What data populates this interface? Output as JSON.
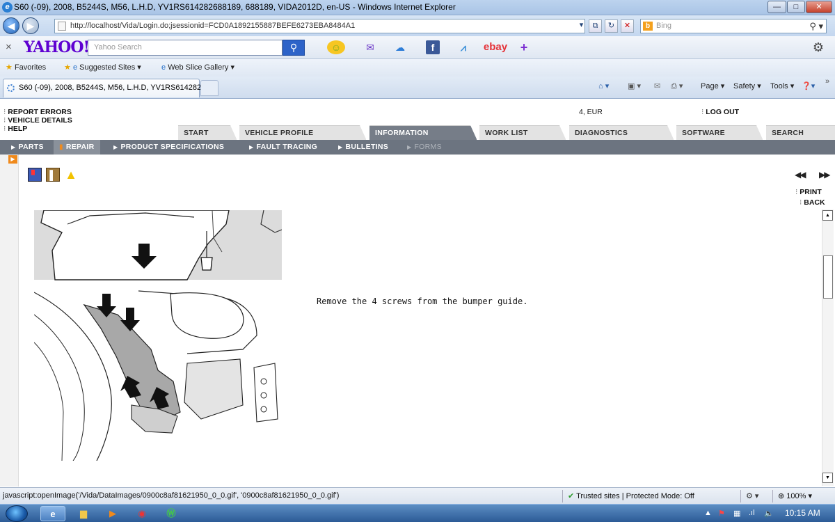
{
  "window": {
    "title": "S60 (-09), 2008, B5244S, M56, L.H.D, YV1RS614282688189, 688189, VIDA2012D, en-US - Windows Internet Explorer",
    "minimize": "—",
    "maximize": "□",
    "close": "✕"
  },
  "address": {
    "url": "http://localhost/Vida/Login.do;jsessionid=FCD0A1892155887BEFE6273EBA8484A1",
    "search_placeholder": "Bing"
  },
  "yahoo": {
    "close": "×",
    "logo": "YAHOO!",
    "search_placeholder": "Yahoo Search",
    "ebay": "ebay"
  },
  "favorites": {
    "favorites_label": "Favorites",
    "suggested_label": "Suggested Sites ▾",
    "gallery_label": "Web Slice Gallery ▾"
  },
  "tab": {
    "label": "S60 (-09), 2008, B5244S, M56, L.H.D, YV1RS614282..."
  },
  "commands": {
    "page": "Page ▾",
    "safety": "Safety ▾",
    "tools": "Tools ▾"
  },
  "vida": {
    "links": [
      "REPORT ERRORS",
      "VEHICLE DETAILS",
      "HELP"
    ],
    "locale": "4, EUR",
    "logout": "LOG OUT",
    "main_tabs": [
      "START",
      "VEHICLE PROFILE",
      "INFORMATION",
      "WORK LIST",
      "DIAGNOSTICS",
      "SOFTWARE",
      "SEARCH"
    ],
    "active_tab": "INFORMATION",
    "sub_tabs": [
      "PARTS",
      "REPAIR",
      "PRODUCT SPECIFICATIONS",
      "FAULT TRACING",
      "BULLETINS",
      "FORMS"
    ],
    "active_sub_tab": "REPAIR",
    "print": "PRINT",
    "back": "BACK",
    "prev": "◀◀",
    "next": "▶▶",
    "instruction": "Remove the 4 screws from the bumper guide."
  },
  "status": {
    "url": "javascript:openImage('/Vida/DataImages/0900c8af81621950_0_0.gif', '0900c8af81621950_0_0.gif')",
    "trusted": "Trusted sites | Protected Mode: Off",
    "zoom": "100%"
  },
  "taskbar": {
    "time": "10:15 AM"
  },
  "colors": {
    "accent_orange": "#f08a1c",
    "subnav_gray": "#6c7480",
    "active_tab": "#767d88",
    "yahoo_purple": "#5f01d1"
  },
  "icons": [
    "ie-icon",
    "back-icon",
    "forward-icon",
    "search-icon",
    "mail-icon",
    "weather-icon",
    "facebook-icon",
    "finance-icon",
    "settings-gear-icon",
    "star-icon",
    "home-icon",
    "rss-icon",
    "print-icon",
    "help-icon",
    "lock-check-icon",
    "windows-start-icon"
  ]
}
